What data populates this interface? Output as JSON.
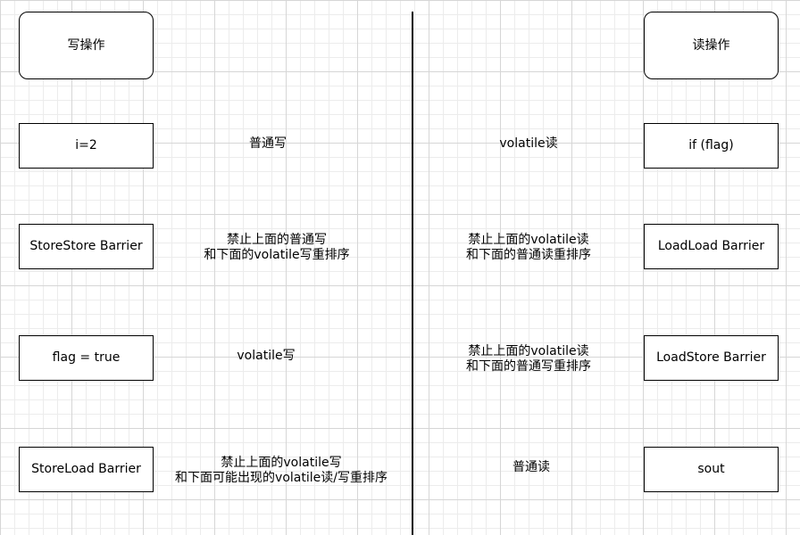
{
  "write_side": {
    "header": "写操作",
    "steps": [
      {
        "box": "i=2",
        "note": "普通写"
      },
      {
        "box": "StoreStore Barrier",
        "note": "禁止上面的普通写\n和下面的volatile写重排序"
      },
      {
        "box": "flag = true",
        "note": "volatile写"
      },
      {
        "box": "StoreLoad Barrier",
        "note": "禁止上面的volatile写\n和下面可能出现的volatile读/写重排序"
      }
    ]
  },
  "read_side": {
    "header": "读操作",
    "steps": [
      {
        "box": "if (flag)",
        "note": "volatile读"
      },
      {
        "box": "LoadLoad Barrier",
        "note": "禁止上面的volatile读\n和下面的普通读重排序"
      },
      {
        "box": "LoadStore Barrier",
        "note": "禁止上面的volatile读\n和下面的普通写重排序"
      },
      {
        "box": "sout",
        "note": "普通读"
      }
    ]
  }
}
